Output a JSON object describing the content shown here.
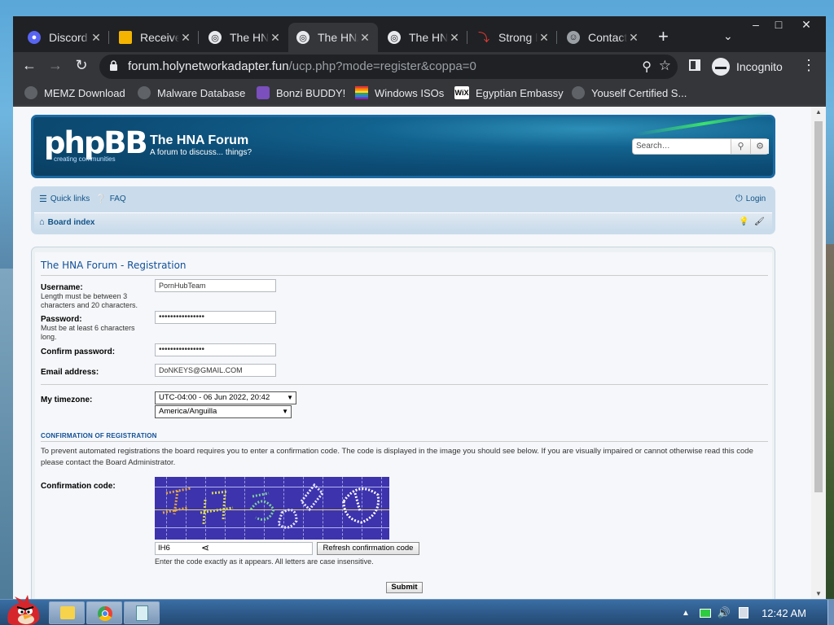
{
  "browser": {
    "tabs": [
      {
        "title": "Discord",
        "icon": "discord-icon",
        "color": "#5865f2"
      },
      {
        "title": "Receive",
        "icon": "folder-icon",
        "color": "#f4b400"
      },
      {
        "title": "The HNA",
        "icon": "globe-icon",
        "color": "#e8eaed"
      },
      {
        "title": "The HNA",
        "icon": "globe-icon",
        "color": "#e8eaed"
      },
      {
        "title": "The HNA",
        "icon": "globe-icon",
        "color": "#e8eaed"
      },
      {
        "title": "Strong l",
        "icon": "pushbullet-icon",
        "color": "#e53935"
      },
      {
        "title": "Contact",
        "icon": "contact-icon",
        "color": "#9aa0a6"
      }
    ],
    "active_tab": 3,
    "url_host": "forum.holynetworkadapter.fun",
    "url_path": "/ucp.php?mode=register&coppa=0",
    "profile_label": "Incognito",
    "bookmarks": [
      {
        "label": "MEMZ Download",
        "icon": "globe-icon",
        "color": "#5f6368"
      },
      {
        "label": "Malware Database",
        "icon": "globe-icon",
        "color": "#5f6368"
      },
      {
        "label": "Bonzi BUDDY!",
        "icon": "bonzi-icon",
        "color": "#7b4fbd"
      },
      {
        "label": "Windows ISOs",
        "icon": "rainbow-icon",
        "color": "#e53935"
      },
      {
        "label": "Egyptian Embassy",
        "icon": "wix-icon",
        "color": "#ffffff"
      },
      {
        "label": "Youself Certified S...",
        "icon": "globe-icon",
        "color": "#5f6368"
      }
    ]
  },
  "forum": {
    "logo_text": "phpBB",
    "logo_sub": "creating communities",
    "site_name": "The HNA Forum",
    "site_desc": "A forum to discuss... things?",
    "search_placeholder": "Search…",
    "nav": {
      "quick_links": "Quick links",
      "faq": "FAQ",
      "login": "Login",
      "board_index": "Board index"
    },
    "page_title": "The HNA Forum - Registration",
    "form": {
      "username_label": "Username:",
      "username_explain": "Length must be between 3 characters and 20 characters.",
      "username_value": "PornHubTeam",
      "password_label": "Password:",
      "password_explain": "Must be at least 6 characters long.",
      "password_value": "••••••••••••••••",
      "confirm_label": "Confirm password:",
      "confirm_value": "••••••••••••••••",
      "email_label": "Email address:",
      "email_value": "DoNKEYS@GMAIL.COM",
      "timezone_label": "My timezone:",
      "timezone_value": "UTC-04:00 - 06 Jun 2022, 20:42",
      "timezone_region": "America/Anguilla",
      "confirm_heading": "CONFIRMATION OF REGISTRATION",
      "confirm_text": "To prevent automated registrations the board requires you to enter a confirmation code. The code is displayed in the image you should see below. If you are visually impaired or cannot otherwise read this code please contact the Board Administrator.",
      "code_label": "Confirmation code:",
      "code_value": "IH6",
      "refresh_label": "Refresh confirmation code",
      "code_hint": "Enter the code exactly as it appears. All letters are case insensitive.",
      "submit_label": "Submit"
    }
  },
  "taskbar": {
    "clock": "12:42 AM"
  }
}
